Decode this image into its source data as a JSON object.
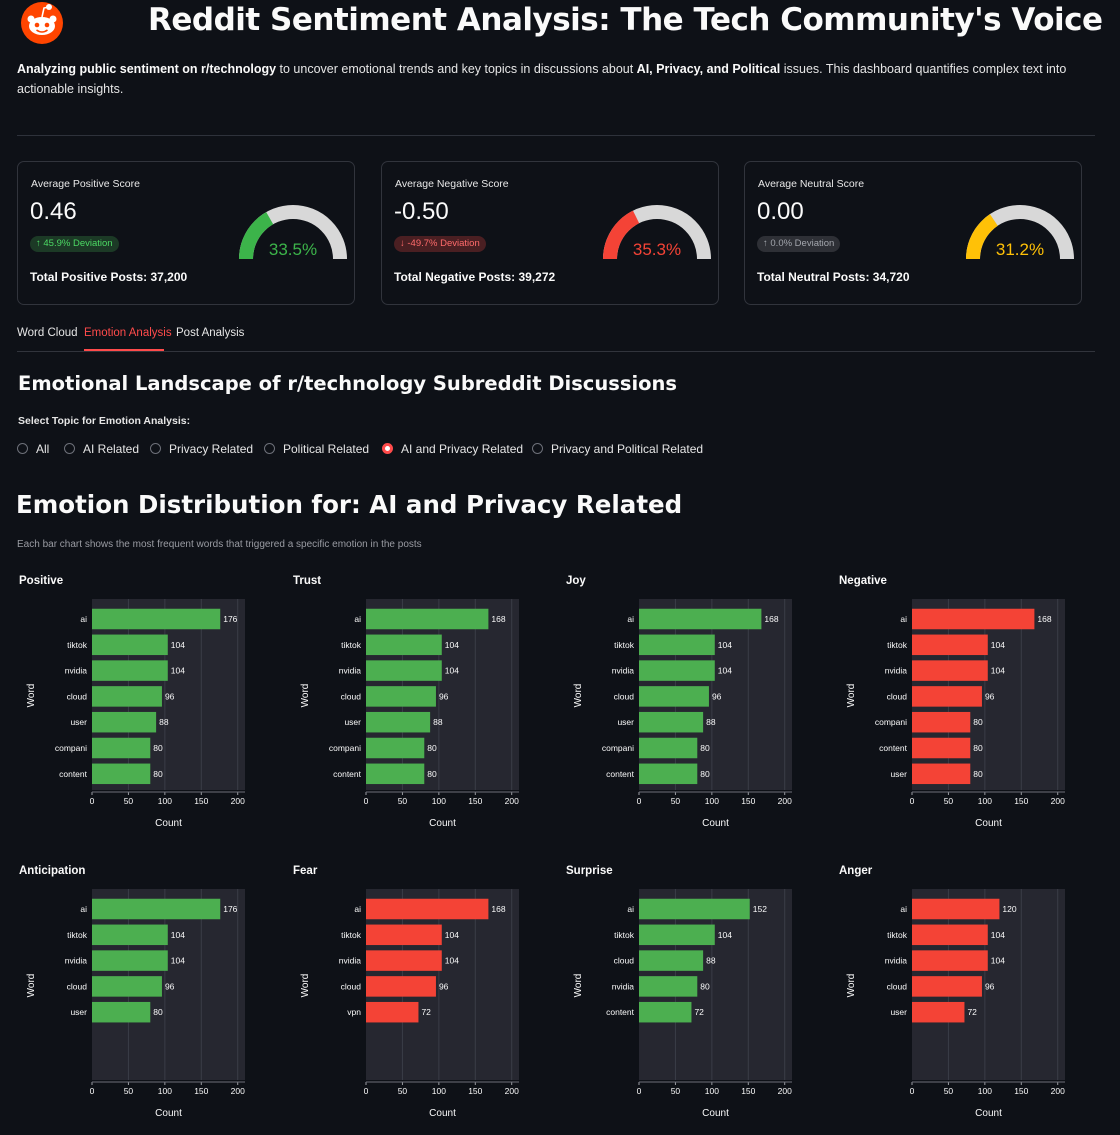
{
  "header": {
    "title": "Reddit Sentiment Analysis: The Tech Community's Voice",
    "logo_icon": "reddit-logo-icon"
  },
  "intro": {
    "lead_bold": "Analyzing public sentiment on r/technology",
    "part1": " to uncover emotional trends and key topics in discussions about ",
    "topics_bold": "AI, Privacy, and Political",
    "part2": " issues. This dashboard quantifies complex text into actionable insights."
  },
  "metrics": [
    {
      "label": "Average Positive Score",
      "value": "0.46",
      "arrow": "↑",
      "deviation": "45.9% Deviation",
      "total": "Total Positive Posts: 37,200",
      "gauge_percent": 33.5,
      "gauge_label": "33.5%",
      "color": "#3cb44a",
      "badge_bg": "#1c3a26",
      "badge_fg": "#4cd964"
    },
    {
      "label": "Average Negative Score",
      "value": "-0.50",
      "arrow": "↓",
      "deviation": "-49.7% Deviation",
      "total": "Total Negative Posts: 39,272",
      "gauge_percent": 35.3,
      "gauge_label": "35.3%",
      "color": "#f44336",
      "badge_bg": "#4a1f22",
      "badge_fg": "#ff6b6b"
    },
    {
      "label": "Average Neutral Score",
      "value": "0.00",
      "arrow": "↑",
      "deviation": "0.0% Deviation",
      "total": "Total Neutral Posts: 34,720",
      "gauge_percent": 31.2,
      "gauge_label": "31.2%",
      "color": "#ffc107",
      "badge_bg": "#2e3036",
      "badge_fg": "#a3a6ad"
    }
  ],
  "tabs": [
    {
      "label": "Word Cloud",
      "active": false
    },
    {
      "label": "Emotion Analysis",
      "active": true
    },
    {
      "label": "Post Analysis",
      "active": false
    }
  ],
  "emotion_section": {
    "title": "Emotional Landscape of r/technology Subreddit Discussions",
    "radio_label": "Select Topic for Emotion Analysis:",
    "options": [
      "All",
      "AI Related",
      "Privacy Related",
      "Political Related",
      "AI and Privacy Related",
      "Privacy and Political Related"
    ],
    "selected": "AI and Privacy Related"
  },
  "distribution": {
    "title": "Emotion Distribution for: AI and Privacy Related",
    "caption": "Each bar chart shows the most frequent words that triggered a specific emotion in the posts"
  },
  "colors": {
    "positive": "#4caf50",
    "negative": "#f44336",
    "plot_bg": "#262730",
    "accent": "#ff4b4b"
  },
  "chart_data": [
    {
      "type": "bar",
      "orientation": "horizontal",
      "title": "Positive",
      "xlabel": "Count",
      "ylabel": "Word",
      "xlim": [
        0,
        210
      ],
      "xticks": [
        0,
        50,
        100,
        150,
        200
      ],
      "color": "#4caf50",
      "categories": [
        "ai",
        "tiktok",
        "nvidia",
        "cloud",
        "user",
        "compani",
        "content"
      ],
      "values": [
        176,
        104,
        104,
        96,
        88,
        80,
        80
      ]
    },
    {
      "type": "bar",
      "orientation": "horizontal",
      "title": "Trust",
      "xlabel": "Count",
      "ylabel": "Word",
      "xlim": [
        0,
        210
      ],
      "xticks": [
        0,
        50,
        100,
        150,
        200
      ],
      "color": "#4caf50",
      "categories": [
        "ai",
        "tiktok",
        "nvidia",
        "cloud",
        "user",
        "compani",
        "content"
      ],
      "values": [
        168,
        104,
        104,
        96,
        88,
        80,
        80
      ]
    },
    {
      "type": "bar",
      "orientation": "horizontal",
      "title": "Joy",
      "xlabel": "Count",
      "ylabel": "Word",
      "xlim": [
        0,
        210
      ],
      "xticks": [
        0,
        50,
        100,
        150,
        200
      ],
      "color": "#4caf50",
      "categories": [
        "ai",
        "tiktok",
        "nvidia",
        "cloud",
        "user",
        "compani",
        "content"
      ],
      "values": [
        168,
        104,
        104,
        96,
        88,
        80,
        80
      ]
    },
    {
      "type": "bar",
      "orientation": "horizontal",
      "title": "Negative",
      "xlabel": "Count",
      "ylabel": "Word",
      "xlim": [
        0,
        210
      ],
      "xticks": [
        0,
        50,
        100,
        150,
        200
      ],
      "color": "#f44336",
      "categories": [
        "ai",
        "tiktok",
        "nvidia",
        "cloud",
        "compani",
        "content",
        "user"
      ],
      "values": [
        168,
        104,
        104,
        96,
        80,
        80,
        80
      ]
    },
    {
      "type": "bar",
      "orientation": "horizontal",
      "title": "Anticipation",
      "xlabel": "Count",
      "ylabel": "Word",
      "xlim": [
        0,
        210
      ],
      "xticks": [
        0,
        50,
        100,
        150,
        200
      ],
      "color": "#4caf50",
      "categories": [
        "ai",
        "tiktok",
        "nvidia",
        "cloud",
        "user"
      ],
      "values": [
        176,
        104,
        104,
        96,
        80
      ]
    },
    {
      "type": "bar",
      "orientation": "horizontal",
      "title": "Fear",
      "xlabel": "Count",
      "ylabel": "Word",
      "xlim": [
        0,
        210
      ],
      "xticks": [
        0,
        50,
        100,
        150,
        200
      ],
      "color": "#f44336",
      "categories": [
        "ai",
        "tiktok",
        "nvidia",
        "cloud",
        "vpn"
      ],
      "values": [
        168,
        104,
        104,
        96,
        72
      ]
    },
    {
      "type": "bar",
      "orientation": "horizontal",
      "title": "Surprise",
      "xlabel": "Count",
      "ylabel": "Word",
      "xlim": [
        0,
        210
      ],
      "xticks": [
        0,
        50,
        100,
        150,
        200
      ],
      "color": "#4caf50",
      "categories": [
        "ai",
        "tiktok",
        "cloud",
        "nvidia",
        "content"
      ],
      "values": [
        152,
        104,
        88,
        80,
        72
      ]
    },
    {
      "type": "bar",
      "orientation": "horizontal",
      "title": "Anger",
      "xlabel": "Count",
      "ylabel": "Word",
      "xlim": [
        0,
        210
      ],
      "xticks": [
        0,
        50,
        100,
        150,
        200
      ],
      "color": "#f44336",
      "categories": [
        "ai",
        "tiktok",
        "nvidia",
        "cloud",
        "user"
      ],
      "values": [
        120,
        104,
        104,
        96,
        72
      ]
    }
  ]
}
